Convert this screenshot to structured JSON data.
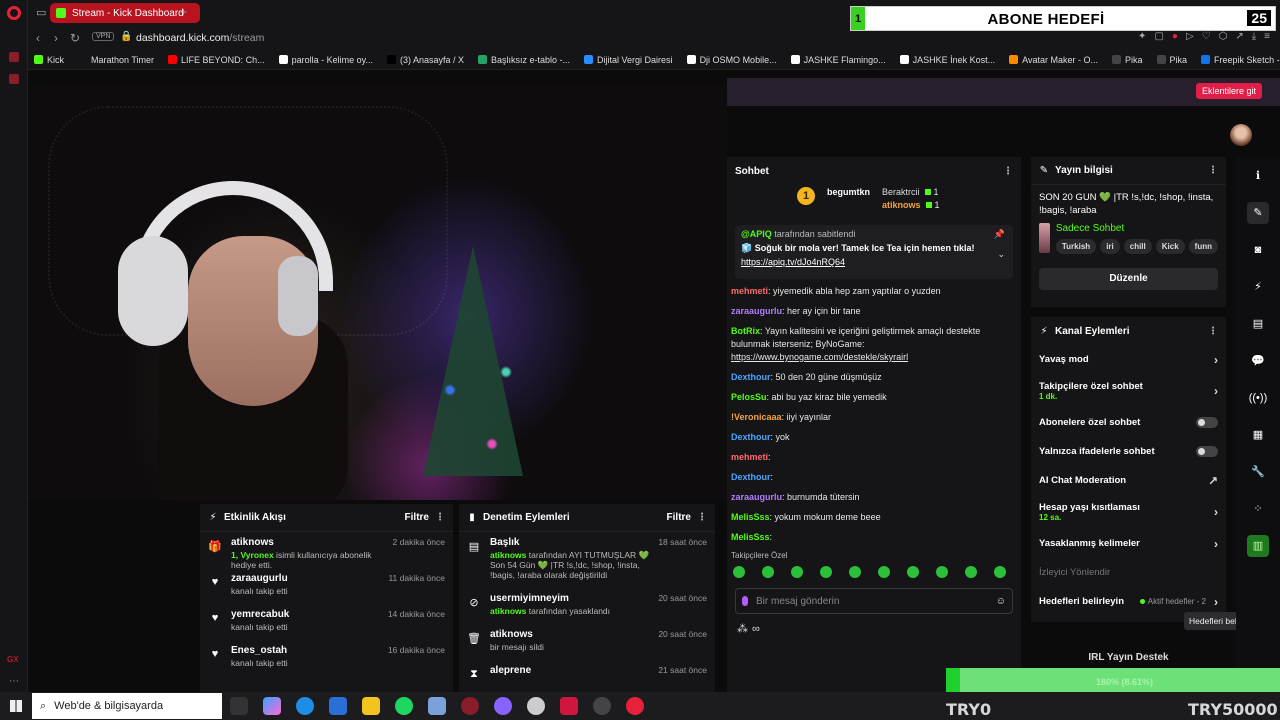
{
  "browser": {
    "tab_title": "Stream - Kick Dashboard",
    "vpn_label": "VPN",
    "url_domain": "dashboard.kick.com",
    "url_path": "/stream",
    "bookmarks": [
      {
        "label": "Kick",
        "color": "#53fc18"
      },
      {
        "label": "Marathon Timer",
        "color": "#151517"
      },
      {
        "label": "LIFE BEYOND: Ch...",
        "color": "#ff0000"
      },
      {
        "label": "parolla - Kelime oy...",
        "color": "#ffffff"
      },
      {
        "label": "(3) Anasayfa / X",
        "color": "#000000"
      },
      {
        "label": "Başlıksız e-tablo -...",
        "color": "#21a464"
      },
      {
        "label": "Dijital Vergi Dairesi",
        "color": "#2a8cff"
      },
      {
        "label": "Dji OSMO Mobile...",
        "color": "#ffffff"
      },
      {
        "label": "JASHKE Flamingo...",
        "color": "#ffffff"
      },
      {
        "label": "JASHKE İnek Kost...",
        "color": "#ffffff"
      },
      {
        "label": "Avatar Maker - O...",
        "color": "#ff8a00"
      },
      {
        "label": "Pika",
        "color": "#444444"
      },
      {
        "label": "Pika",
        "color": "#444444"
      },
      {
        "label": "Freepik Sketch - F...",
        "color": "#1273eb"
      }
    ],
    "extension_button": "Eklentilere git"
  },
  "overlay": {
    "goal_prefix": "1",
    "goal_title": "ABONE HEDEFİ",
    "goal_count": "25",
    "donate_text": "180% (8.61%)",
    "try_left": "TRY0",
    "try_right": "TRY50000"
  },
  "activity": {
    "title": "Etkinlik Akışı",
    "filter": "Filtre",
    "items": [
      {
        "user": "atiknows",
        "sub_hl": "1, Vyronex",
        "sub": " isimli kullanıcıya abonelik hediye etti.",
        "time": "2 dakika önce",
        "icon": "gift-icon",
        "glyph": "🎁"
      },
      {
        "user": "zaraaugurlu",
        "sub_hl": "",
        "sub": "kanalı takip etti",
        "time": "11 dakika önce",
        "icon": "heart-icon",
        "glyph": "♥"
      },
      {
        "user": "yemrecabuk",
        "sub_hl": "",
        "sub": "kanalı takip etti",
        "time": "14 dakika önce",
        "icon": "heart-icon",
        "glyph": "♥"
      },
      {
        "user": "Enes_ostah",
        "sub_hl": "",
        "sub": "kanalı takip etti",
        "time": "16 dakika önce",
        "icon": "heart-icon",
        "glyph": "♥"
      }
    ]
  },
  "moderation": {
    "title": "Denetim Eylemleri",
    "filter": "Filtre",
    "items": [
      {
        "user": "Başlık",
        "sub_hl": "atiknows",
        "sub": " tarafından AYI TUTMUŞLAR 💚 Son 54 Gün 💚 |TR !s,!dc, !shop, !insta, !bagis, !araba olarak değiştirildi",
        "time": "18 saat önce",
        "icon": "title-icon",
        "glyph": "▤"
      },
      {
        "user": "usermiyimneyim",
        "sub_hl": "atiknows",
        "sub": " tarafından yasaklandı",
        "time": "20 saat önce",
        "icon": "ban-icon",
        "glyph": "⊘"
      },
      {
        "user": "atiknows",
        "sub_hl": "",
        "sub": "bir mesajı sildi",
        "time": "20 saat önce",
        "icon": "trash-icon",
        "glyph": "🗑"
      },
      {
        "user": "aleprene",
        "sub_hl": "",
        "sub": "",
        "time": "21 saat önce",
        "icon": "timeout-icon",
        "glyph": "⧗"
      }
    ]
  },
  "chat": {
    "title": "Sohbet",
    "leaderboard": {
      "top_rank": "1",
      "top_user": "begumtkn",
      "second_user": "Beraktrcii",
      "second_count": "1",
      "third_user": "atiknows",
      "third_count": "1"
    },
    "pinned": {
      "pinned_by_user": "@APIQ",
      "pinned_by_text": " tarafından sabitlendi",
      "message": "🧊 Soğuk bir mola ver! Tamek Ice Tea için hemen tıkla!",
      "link": "https://apiq.tv/dJo4nRQ64"
    },
    "messages": [
      {
        "user": "mehmeti",
        "color": "#ff6b6b",
        "text": ": yiyemedik abla hep zam yaptılar o yuzden"
      },
      {
        "user": "zaraaugurlu",
        "color": "#b07cff",
        "text": ": her ay için bir tane"
      },
      {
        "user": "BotRix",
        "color": "#53fc18",
        "text": ": Yayın kalitesini ve içeriğini geliştirmek amaçlı destekte bulunmak isterseniz; ByNoGame: ",
        "link": "https://www.bynogame.com/destekle/skyrairl"
      },
      {
        "user": "Dexthour",
        "color": "#4aa3ff",
        "text": ": 50 den 20 güne düşmüşüz"
      },
      {
        "user": "PelosSu",
        "color": "#53fc18",
        "text": ": abi bu yaz kiraz bile yemedik"
      },
      {
        "user": "!Veronicaaa",
        "color": "#f2a33a",
        "text": ": iiyi yayınlar"
      },
      {
        "user": "Dexthour",
        "color": "#4aa3ff",
        "text": ": yok"
      },
      {
        "user": "mehmeti",
        "color": "#ff6b6b",
        "text": ":"
      },
      {
        "user": "Dexthour",
        "color": "#4aa3ff",
        "text": ":"
      },
      {
        "user": "zaraaugurlu",
        "color": "#b07cff",
        "text": ": burnumda tütersin"
      },
      {
        "user": "MelisSss",
        "color": "#53fc18",
        "text": ": yokum mokum deme beee"
      },
      {
        "user": "MelisSss",
        "color": "#53fc18",
        "text": ":"
      }
    ],
    "emote_label": "Takipçilere Özel",
    "input_placeholder": "Bir mesaj gönderin"
  },
  "stream_info": {
    "title": "Yayın bilgisi",
    "stream_title": "SON 20 GUN 💚 |TR !s,!dc, !shop, !insta, !bagis, !araba",
    "category": "Sadece Sohbet",
    "tags": [
      "Turkish",
      "iri",
      "chill",
      "Kick",
      "funn"
    ],
    "edit_button": "Düzenle"
  },
  "channel_actions": {
    "title": "Kanal Eylemleri",
    "slow_mode": "Yavaş mod",
    "followers_only": "Takipçilere özel sohbet",
    "followers_only_sub": "1 dk.",
    "subs_only": "Abonelere özel sohbet",
    "emotes_only": "Yalnızca ifadelerle sohbet",
    "ai_moderation": "AI Chat Moderation",
    "account_age": "Hesap yaşı kısıtlaması",
    "account_age_sub": "12 sa.",
    "banned_words": "Yasaklanmış kelimeler",
    "viewer_redirect": "İzleyici Yönlendir",
    "goals": "Hedefleri belirleyin",
    "goals_status": "Aktif hedefler - 2",
    "tooltip": "Hedefleri belirleyin"
  },
  "irl_title": "IRL Yayın Destek",
  "taskbar": {
    "search_placeholder": "Web'de & bilgisayarda"
  }
}
